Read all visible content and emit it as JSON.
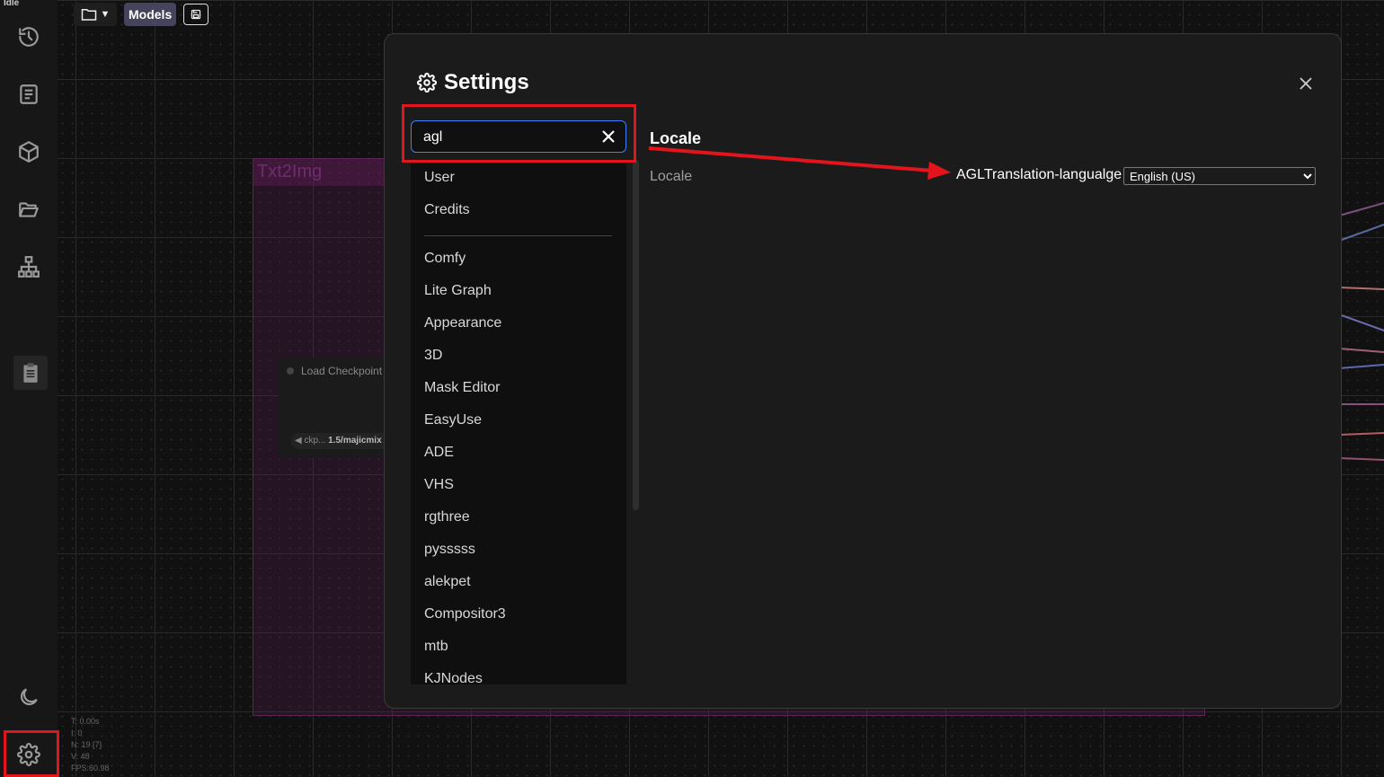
{
  "status": "Idle",
  "topbar": {
    "models_label": "Models"
  },
  "group": {
    "title": "Txt2Img"
  },
  "node": {
    "title": "Load Checkpoint",
    "widget_name": "◀ ckp...",
    "widget_value": "1.5/majicmix"
  },
  "stats": [
    "T: 0.00s",
    "I: 0",
    "N: 19 [7]",
    "V: 48",
    "FPS:60.98"
  ],
  "modal": {
    "title": "Settings",
    "search": {
      "value": "agl"
    },
    "categories": [
      "User",
      "Credits",
      "Comfy",
      "Lite Graph",
      "Appearance",
      "3D",
      "Mask Editor",
      "EasyUse",
      "ADE",
      "VHS",
      "rgthree",
      "pysssss",
      "alekpet",
      "Compositor3",
      "mtb",
      "KJNodes"
    ],
    "section": "Locale",
    "setting": {
      "label": "Locale",
      "name": "AGLTranslation-langualge",
      "value": "English (US)"
    }
  },
  "colors": {
    "highlight": "#e3141c",
    "accent": "#3b82f6"
  },
  "icons": [
    "history-icon",
    "document-icon",
    "cube-icon",
    "folder-open-icon",
    "workflow-icon",
    "clipboard-icon",
    "moon-icon",
    "gear-icon",
    "folder-icon",
    "save-icon",
    "close-icon"
  ]
}
